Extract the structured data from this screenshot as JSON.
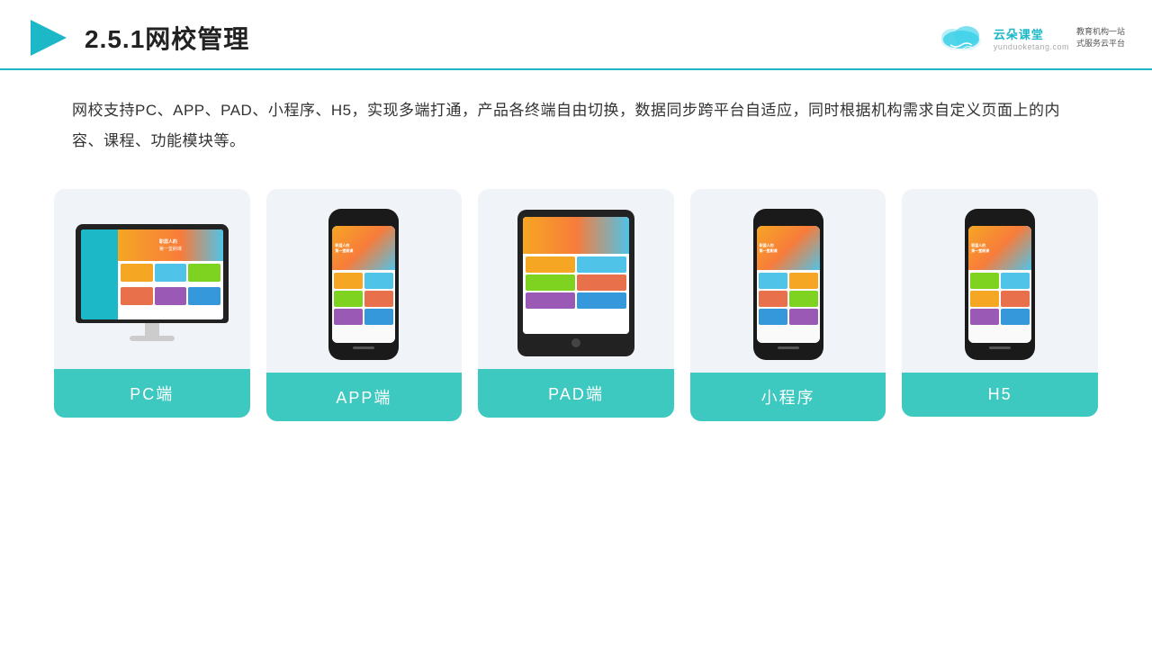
{
  "header": {
    "section_number": "2.5.1",
    "title": "网校管理",
    "logo_main": "云朵课堂",
    "logo_url": "yunduoketang.com",
    "logo_slogan_line1": "教育机构一站",
    "logo_slogan_line2": "式服务云平台"
  },
  "description": {
    "text": "网校支持PC、APP、PAD、小程序、H5，实现多端打通，产品各终端自由切换，数据同步跨平台自适应，同时根据机构需求自定义页面上的内容、课程、功能模块等。"
  },
  "cards": [
    {
      "id": "pc",
      "label": "PC端"
    },
    {
      "id": "app",
      "label": "APP端"
    },
    {
      "id": "pad",
      "label": "PAD端"
    },
    {
      "id": "miniprogram",
      "label": "小程序"
    },
    {
      "id": "h5",
      "label": "H5"
    }
  ]
}
